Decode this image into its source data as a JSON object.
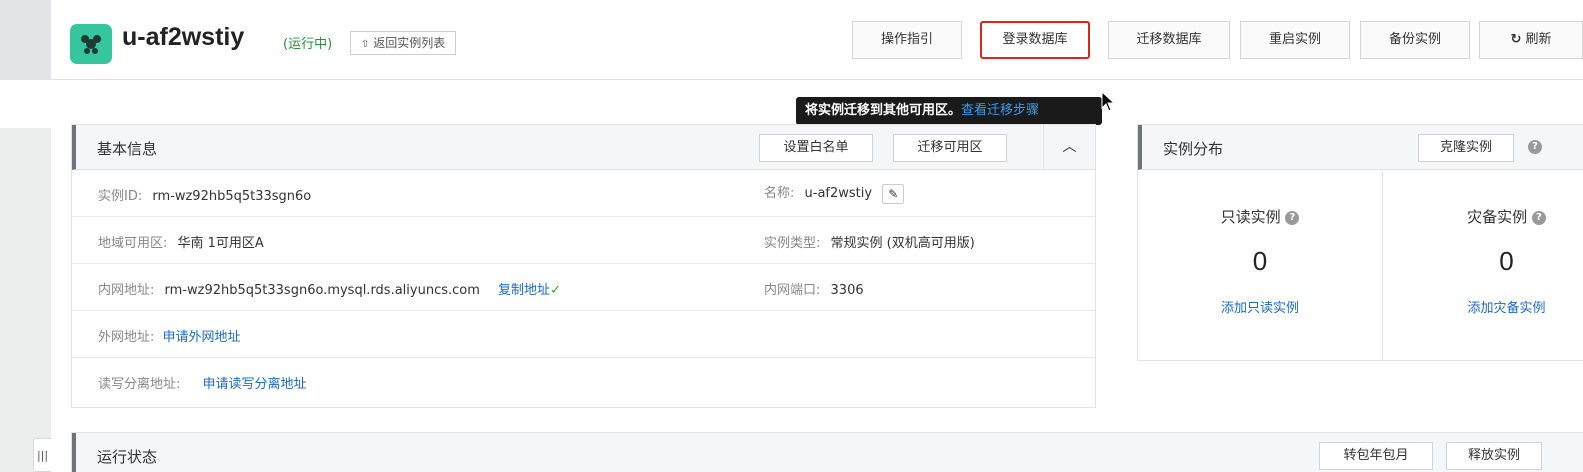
{
  "header": {
    "title": "u-af2wstiy",
    "status": "(运行中)",
    "back_label": "返回实例列表",
    "back_icon": "arrow-up-icon",
    "logo_icon": "rds-logo-icon",
    "buttons": {
      "guide": "操作指引",
      "login_db": "登录数据库",
      "migrate_db": "迁移数据库",
      "restart": "重启实例",
      "backup": "备份实例",
      "refresh": "刷新"
    },
    "refresh_icon": "refresh-icon"
  },
  "tooltip": {
    "text": "将实例迁移到其他可用区。",
    "link": "查看迁移步骤"
  },
  "basic_info": {
    "title": "基本信息",
    "whitelist_btn": "设置白名单",
    "migrate_zone_btn": "迁移可用区",
    "collapse_icon": "chevron-up-icon",
    "instance_id_label": "实例ID:",
    "instance_id_value": "rm-wz92hb5q5t33sgn6o",
    "name_label": "名称:",
    "name_value": "u-af2wstiy",
    "region_label": "地域可用区:",
    "region_value": "华南 1可用区A",
    "type_label": "实例类型:",
    "type_value": "常规实例 (双机高可用版)",
    "intranet_label": "内网地址:",
    "intranet_value": "rm-wz92hb5q5t33sgn6o.mysql.rds.aliyuncs.com",
    "copy_label": "复制地址",
    "port_label": "内网端口:",
    "port_value": "3306",
    "public_label": "外网地址:",
    "public_link": "申请外网地址",
    "rw_label": "读写分离地址:",
    "rw_link": "申请读写分离地址"
  },
  "distribution": {
    "title": "实例分布",
    "clone_btn": "克隆实例",
    "readonly_title": "只读实例",
    "readonly_count": "0",
    "readonly_link": "添加只读实例",
    "dr_title": "灾备实例",
    "dr_count": "0",
    "dr_link": "添加灾备实例"
  },
  "run_status": {
    "title": "运行状态",
    "convert_btn": "转包年包月",
    "release_btn": "释放实例"
  },
  "colors": {
    "highlight_border": "#e0241b",
    "logo_bg": "#35c6a0",
    "link": "#1b6ac9",
    "status_green": "#2a8f3a"
  }
}
